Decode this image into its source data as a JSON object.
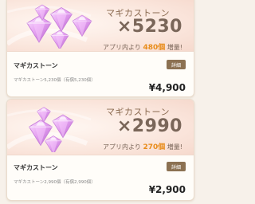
{
  "products": [
    {
      "title": "マギカストーン",
      "quantity": "×5230",
      "bonus_prefix": "アプリ内より",
      "bonus_amount": "480個",
      "bonus_suffix": "増量!",
      "name": "マギカストーン",
      "detail_label": "詳細",
      "description": "マギカストーン5,230個（有償5,230個）",
      "price": "¥4,900"
    },
    {
      "title": "マギカストーン",
      "quantity": "×2990",
      "bonus_prefix": "アプリ内より",
      "bonus_amount": "270個",
      "bonus_suffix": "増量!",
      "name": "マギカストーン",
      "detail_label": "詳細",
      "description": "マギカストーン2,990個（有償2,990個）",
      "price": "¥2,900"
    }
  ],
  "colors": {
    "accent": "#e88c1a",
    "button": "#8c7152",
    "gem": "#d98be8"
  },
  "icons": {
    "gem": "magica-stone-gem-icon"
  }
}
